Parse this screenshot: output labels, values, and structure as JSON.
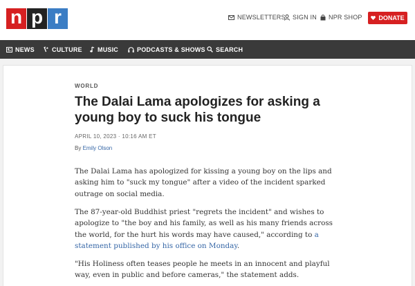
{
  "logo": {
    "letters": [
      "n",
      "p",
      "r"
    ]
  },
  "utility": {
    "newsletters": "NEWSLETTERS",
    "sign_in": "SIGN IN",
    "shop": "NPR SHOP",
    "donate": "DONATE"
  },
  "nav": {
    "items": [
      {
        "label": "NEWS",
        "icon": "news-icon"
      },
      {
        "label": "CULTURE",
        "icon": "culture-icon"
      },
      {
        "label": "MUSIC",
        "icon": "music-icon"
      },
      {
        "label": "PODCASTS & SHOWS",
        "icon": "headphones-icon"
      },
      {
        "label": "SEARCH",
        "icon": "search-icon"
      }
    ]
  },
  "article": {
    "slug": "WORLD",
    "headline": "The Dalai Lama apologizes for asking a young boy to suck his tongue",
    "dateline": "APRIL 10, 2023 · 10:16 AM ET",
    "byline_prefix": "By ",
    "author": "Emily Olson",
    "p1": "The Dalai Lama has apologized for kissing a young boy on the lips and asking him to \"suck my tongue\" after a video of the incident sparked outrage on social media.",
    "p2_text": "The 87-year-old Buddhist priest \"regrets the incident\" and wishes to apologize to \"the boy and his family, as well as his many friends across the world, for the hurt his words may have caused,\" according to ",
    "p2_link": "a statement published by his office on Monday",
    "p2_end": ".",
    "p3": "\"His Holiness often teases people he meets in an innocent and playful way, even in public and before cameras,\" the statement adds."
  },
  "colors": {
    "brand_red": "#d62021",
    "brand_blue": "#3b7dc4",
    "nav_bg": "#3a3a3a",
    "link": "#3566a6"
  }
}
